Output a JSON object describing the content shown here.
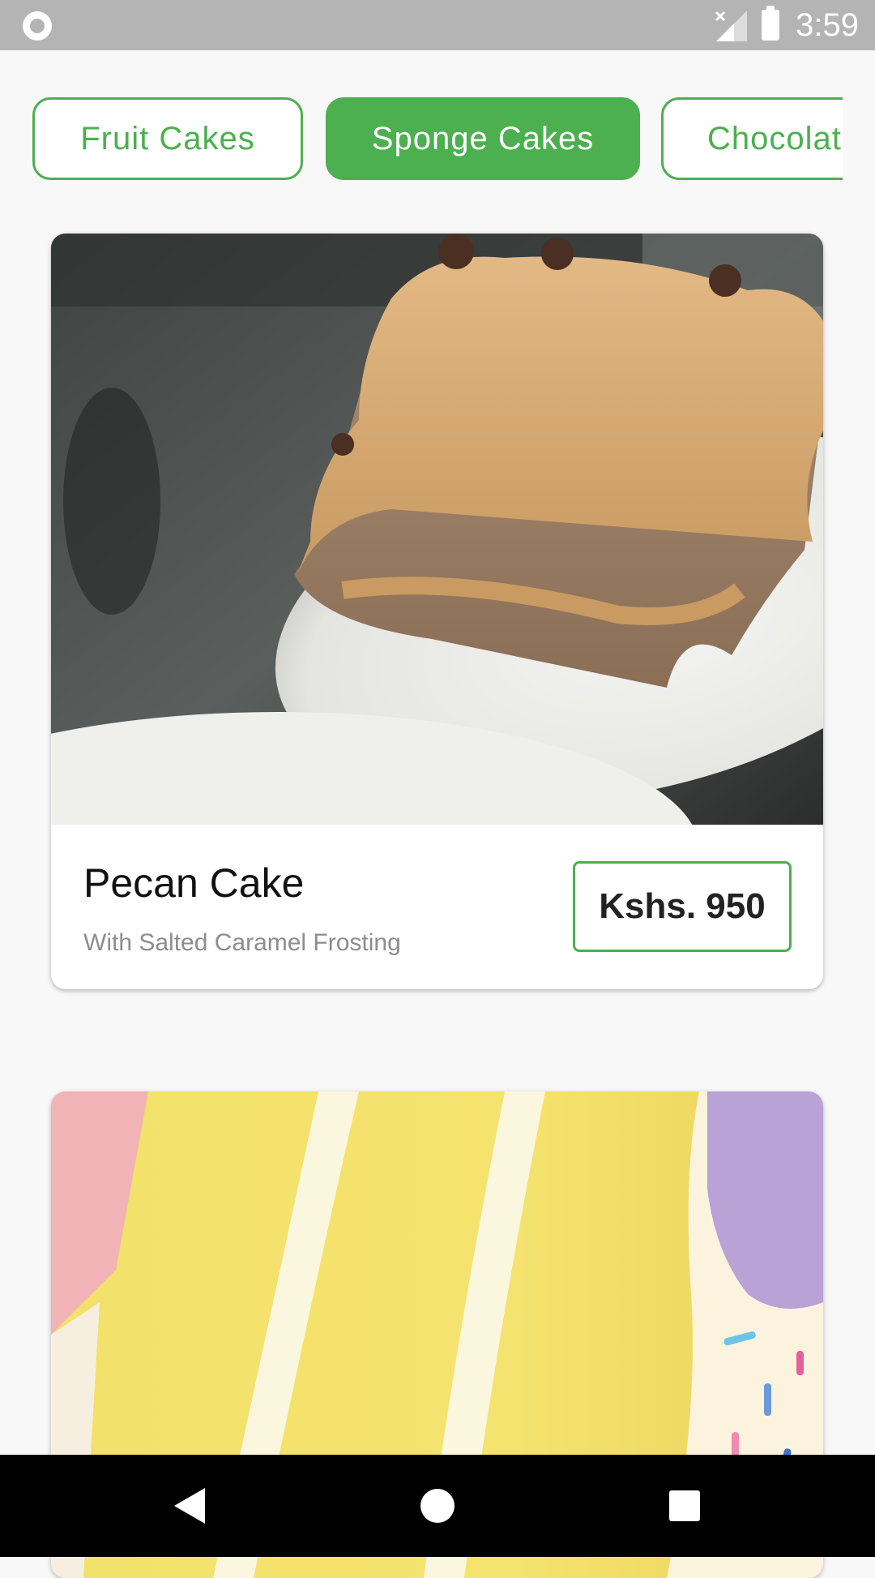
{
  "status_bar": {
    "time": "3:59",
    "icons": [
      "record-icon",
      "no-signal-icon",
      "battery-icon"
    ]
  },
  "categories": [
    {
      "label": "Fruit Cakes",
      "selected": false
    },
    {
      "label": "Sponge Cakes",
      "selected": true
    },
    {
      "label": "Chocolat",
      "selected": false
    }
  ],
  "products": [
    {
      "name": "Pecan Cake",
      "description": "With Salted Caramel Frosting",
      "price": "Kshs. 950",
      "image": "pecan-cake-photo"
    },
    {
      "image": "vanilla-sponge-cake-photo"
    }
  ],
  "nav_bar": {
    "icons": [
      "back-icon",
      "home-icon",
      "recent-apps-icon"
    ]
  },
  "colors": {
    "accent": "#4caf50",
    "status_bar": "#b4b4b4",
    "background": "#f8f8f8"
  }
}
